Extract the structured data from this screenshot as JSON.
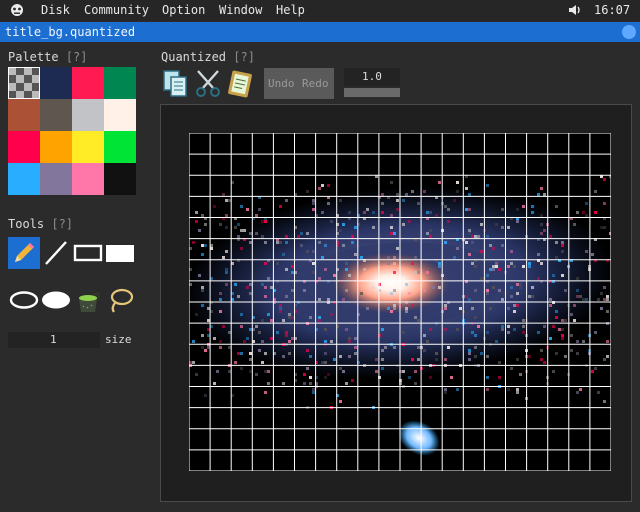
{
  "menubar": {
    "items": [
      "Disk",
      "Community",
      "Option",
      "Window",
      "Help"
    ],
    "clock": "16:07"
  },
  "window": {
    "title": "title_bg.quantized"
  },
  "palette": {
    "title": "Palette",
    "help": "[?]",
    "colors": [
      "#6f6f6f",
      "#1d2b53",
      "#ff1b52",
      "#008751",
      "#ab5236",
      "#5f574f",
      "#c2c3c7",
      "#fff1e8",
      "#ff004d",
      "#ffa300",
      "#ffec27",
      "#00e436",
      "#29adff",
      "#83769c",
      "#ff77a8",
      "#111111"
    ]
  },
  "tools": {
    "title": "Tools",
    "help": "[?]",
    "size_value": "1",
    "size_label": "size"
  },
  "quantized": {
    "title": "Quantized",
    "help": "[?]",
    "undo": "Undo",
    "redo": "Redo",
    "zoom": "1.0"
  },
  "colors": {
    "accent": "#1c6fd0",
    "background": "#2b2b2b",
    "grid": "#ffffff"
  }
}
